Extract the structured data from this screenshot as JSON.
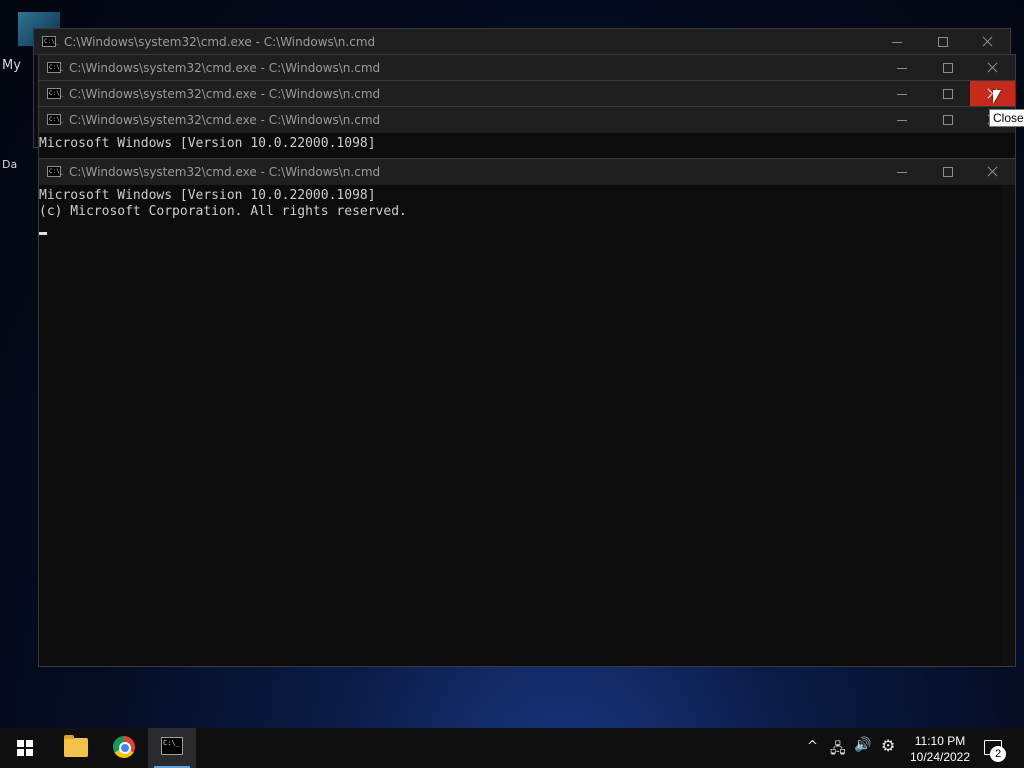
{
  "desktop": {
    "icon_label_1": "My",
    "icon_label_2": "Da"
  },
  "windows": [
    {
      "title": "C:\\Windows\\system32\\cmd.exe - C:\\Windows\\n.cmd"
    },
    {
      "title": "C:\\Windows\\system32\\cmd.exe - C:\\Windows\\n.cmd"
    },
    {
      "title": "C:\\Windows\\system32\\cmd.exe - C:\\Windows\\n.cmd"
    },
    {
      "title": "C:\\Windows\\system32\\cmd.exe - C:\\Windows\\n.cmd",
      "lines": [
        "Microsoft Windows [Version 10.0.22000.1098]"
      ]
    },
    {
      "title": "C:\\Windows\\system32\\cmd.exe - C:\\Windows\\n.cmd",
      "lines": [
        "Microsoft Windows [Version 10.0.22000.1098]",
        "(c) Microsoft Corporation. All rights reserved."
      ]
    }
  ],
  "titlebar_icon_text": "C:\\_",
  "tooltip": "Close",
  "taskbar": {
    "apps": [
      "start",
      "file-explorer",
      "chrome",
      "cmd"
    ],
    "active_app": "cmd",
    "cmd_icon_text": "C:\\_"
  },
  "tray": {
    "chevron": "^",
    "network_icon": "🖧",
    "volume_icon": "🔊",
    "settings_icon": "⚙",
    "time": "11:10 PM",
    "date": "10/24/2022",
    "notification_count": "2"
  },
  "colors": {
    "close_hover": "#c42b1c",
    "console_bg": "#0c0c0c",
    "console_text": "#cccccc",
    "taskbar_active": "#5aa7e8"
  }
}
